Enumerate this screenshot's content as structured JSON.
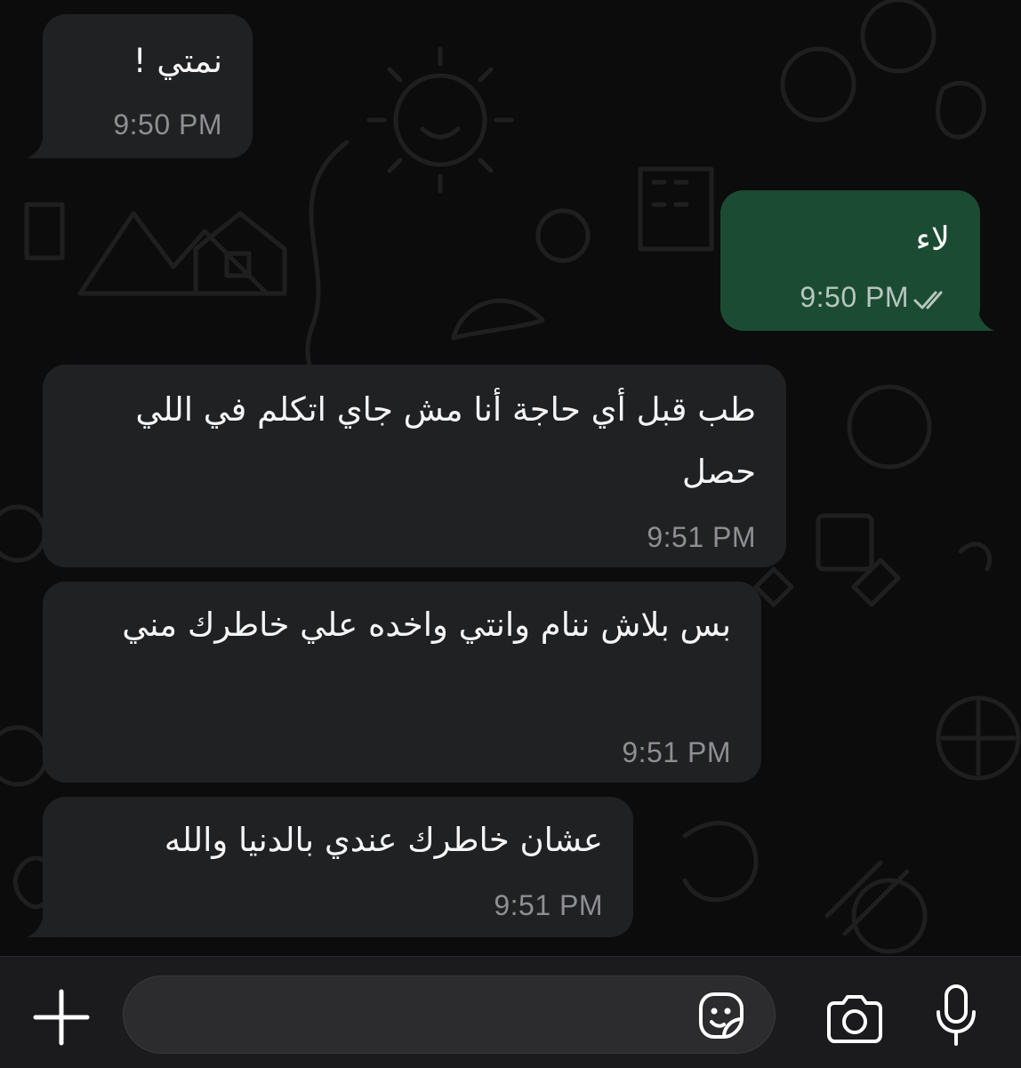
{
  "chat": {
    "messages": [
      {
        "direction": "incoming",
        "text": "نمتي !",
        "time": "9:50 PM"
      },
      {
        "direction": "outgoing",
        "text": "لاء",
        "time": "9:50 PM",
        "status_icon": "double-check-icon"
      },
      {
        "direction": "incoming",
        "text": "طب قبل أي حاجة أنا مش جاي اتكلم في اللي حصل",
        "time": "9:51 PM"
      },
      {
        "direction": "incoming",
        "text": "بس بلاش ننام وانتي واخده علي خاطرك مني",
        "time": "9:51 PM"
      },
      {
        "direction": "incoming",
        "text": "عشان خاطرك عندي بالدنيا والله",
        "time": "9:51 PM"
      }
    ]
  },
  "composer": {
    "input_value": "",
    "icons": [
      "plus-icon",
      "sticker-icon",
      "camera-icon",
      "microphone-icon"
    ]
  },
  "colors": {
    "background": "#0c0c0c",
    "incoming_bubble": "#202123",
    "outgoing_bubble": "#1c4b34",
    "timestamp": "#8e8e93",
    "composer_bar": "#1b1b1d"
  }
}
